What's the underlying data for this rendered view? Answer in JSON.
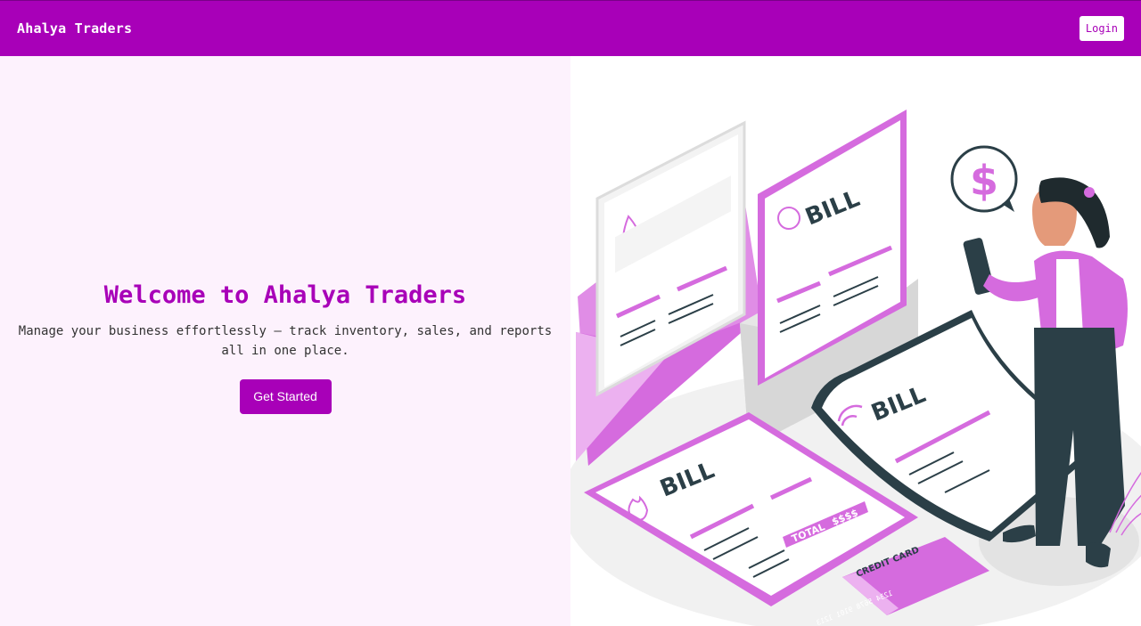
{
  "navbar": {
    "brand": "Ahalya Traders",
    "login_label": "Login"
  },
  "hero": {
    "title": "Welcome to Ahalya Traders",
    "subtitle": "Manage your business effortlessly — track inventory, sales, and reports all in one place.",
    "cta_label": "Get Started"
  },
  "illustration": {
    "bill_label": "BILL",
    "total_label": "TOTAL",
    "total_value": "$$$$",
    "card_label": "CREDIT CARD",
    "card_number": "1234 5678 9101 1213",
    "currency_symbol": "$"
  },
  "colors": {
    "brand": "#a800b8",
    "hero_background": "#fdf2fd",
    "accent_pink": "#d97de0",
    "dark_ink": "#2b3f47"
  }
}
